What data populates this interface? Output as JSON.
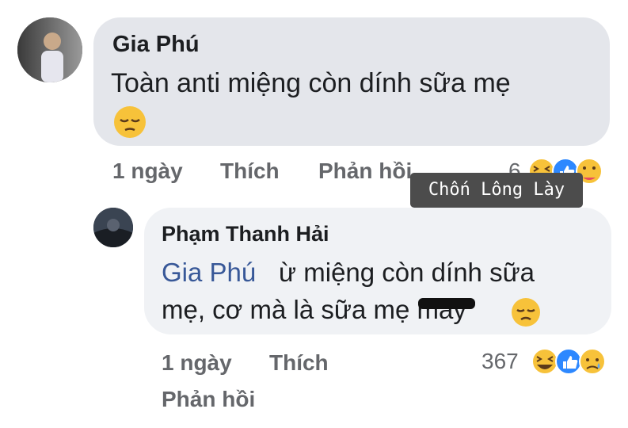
{
  "comment": {
    "author": "Gia Phú",
    "text": "Toàn anti miệng còn dính sữa mẹ",
    "emoji": "pensive-face",
    "meta": {
      "time": "1 ngày",
      "like": "Thích",
      "reply": "Phản hồi",
      "reaction_count": "6"
    },
    "reactions": [
      "haha",
      "like",
      "care"
    ]
  },
  "reply": {
    "author": "Phạm Thanh Hải",
    "mention": "Gia Phú",
    "text_line1": "ừ miệng còn dính sữa",
    "text_line2": "mẹ, cơ mà là sữa mẹ mày",
    "emoji": "disappointed-face",
    "meta": {
      "time": "1 ngày",
      "like": "Thích",
      "reply": "Phản hồi",
      "reaction_count": "367"
    },
    "reactions": [
      "haha",
      "like",
      "sad"
    ]
  },
  "watermark": "Chốn Lông Lày",
  "colors": {
    "bubble": "#e4e6eb",
    "mention": "#385898",
    "muted": "#65676b",
    "like_blue": "#2d88ff",
    "emoji_yellow": "#f7c23a"
  }
}
